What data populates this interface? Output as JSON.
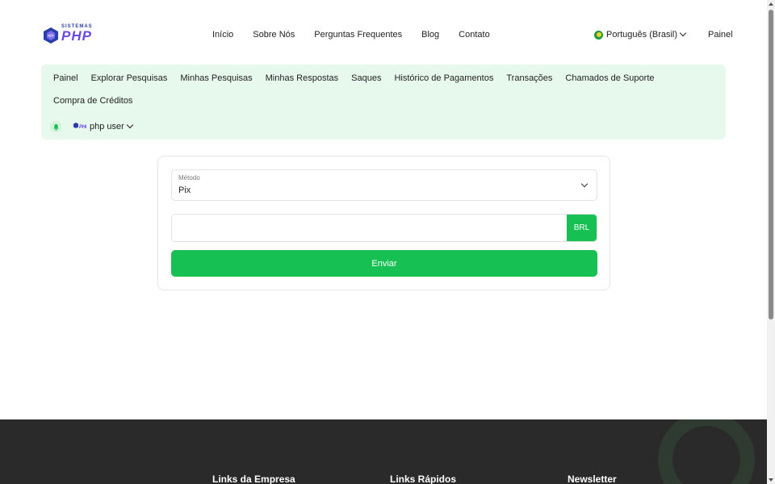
{
  "brand": {
    "small": "SISTEMAS",
    "big": "PHP",
    "icon": "php-hexagon-logo-icon"
  },
  "nav": {
    "items": [
      "Início",
      "Sobre Nós",
      "Perguntas Frequentes",
      "Blog",
      "Contato"
    ]
  },
  "language": {
    "label": "Português (Brasil)",
    "icon": "brazil-flag-icon"
  },
  "header_dashboard_link": "Painel",
  "dashboard": {
    "links": [
      "Painel",
      "Explorar Pesquisas",
      "Minhas Pesquisas",
      "Minhas Respostas",
      "Saques",
      "Histórico de Pagamentos",
      "Transações",
      "Chamados de Suporte"
    ],
    "links_row2": "Compra de Créditos",
    "user_name": "php user",
    "user_avatar_text": "SISTEMAS PHP"
  },
  "form": {
    "method_label": "Método",
    "method_value": "Pix",
    "amount_value": "",
    "currency": "BRL",
    "submit_label": "Enviar"
  },
  "footer": {
    "headings": [
      "Links da Empresa",
      "Links Rápidos",
      "Newsletter"
    ]
  },
  "colors": {
    "accent": "#16c052",
    "dash_bg": "#e7f8ec",
    "footer_bg": "#2a2a2a",
    "brand_purple": "#6a4ce0"
  }
}
